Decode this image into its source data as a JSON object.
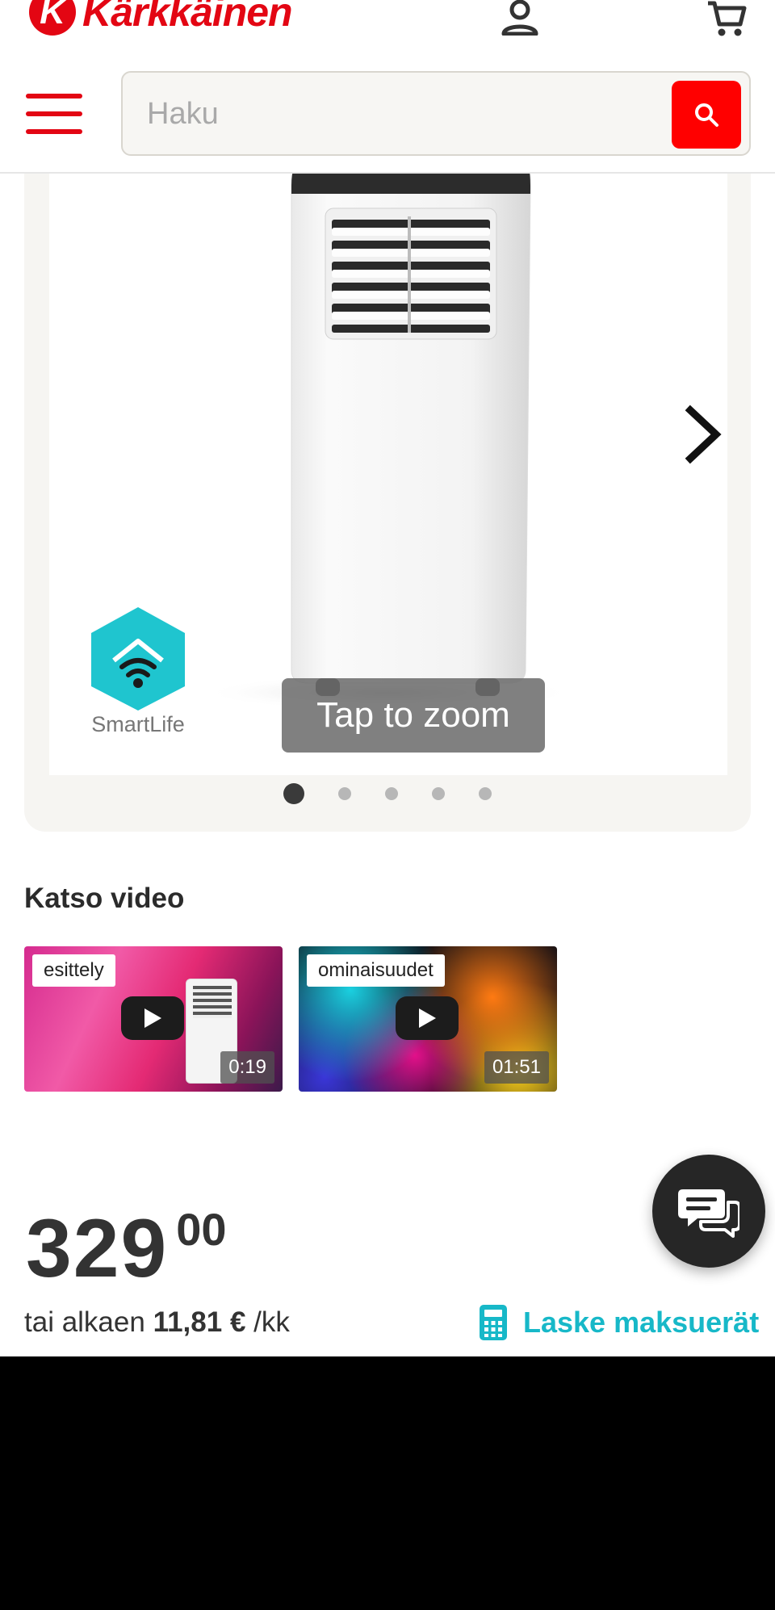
{
  "header": {
    "logo_letter": "K",
    "logo_text": "Kärkkäinen",
    "search": {
      "placeholder": "Haku",
      "value": ""
    },
    "icons": {
      "account": "user-icon",
      "cart": "cart-icon",
      "menu": "hamburger-menu-icon",
      "search": "search-icon"
    }
  },
  "gallery": {
    "zoom_label": "Tap to zoom",
    "badge_text": "SmartLife",
    "slide_count": 5,
    "active_slide": 1,
    "next_icon": "chevron-right-icon"
  },
  "videos": {
    "heading": "Katso video",
    "items": [
      {
        "tag": "esittely",
        "duration": "0:19"
      },
      {
        "tag": "ominaisuudet",
        "duration": "01:51"
      }
    ]
  },
  "price": {
    "main": "329",
    "cents": "00",
    "installment_prefix": "tai alkaen",
    "installment_amount": "11,81 €",
    "installment_suffix": "/kk",
    "calculator_link": "Laske maksuerät"
  },
  "colors": {
    "brand_red": "#e30613",
    "search_button": "#ff0000",
    "link_teal": "#17b8c8",
    "chat_bg": "#262626"
  }
}
